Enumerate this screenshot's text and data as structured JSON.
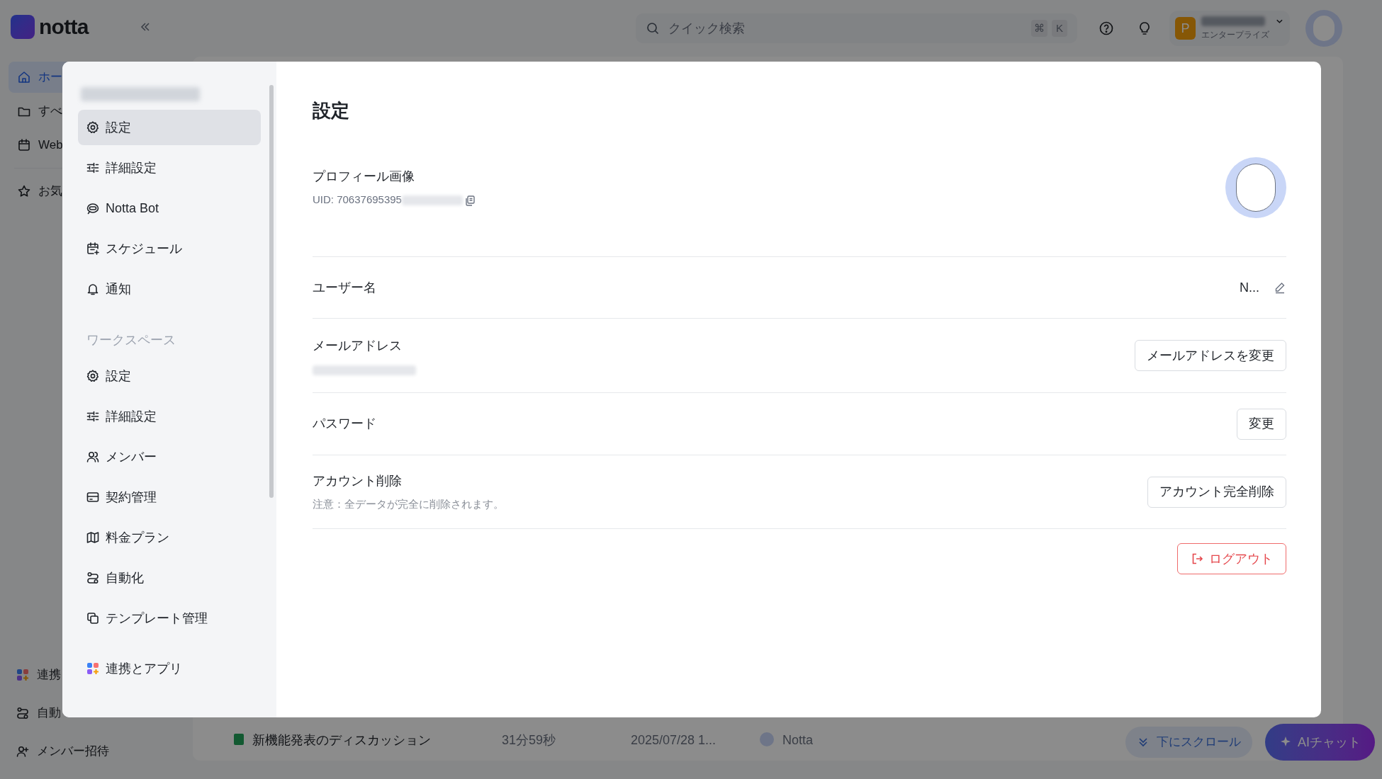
{
  "app": {
    "logo": "notta",
    "search_placeholder": "クイック検索",
    "shortcut_keys": [
      "⌘",
      "K"
    ],
    "user_initial": "P",
    "plan": "エンタープライズ"
  },
  "background_sidebar": {
    "items": [
      {
        "label": "ホー",
        "kind": "home",
        "selected": true
      },
      {
        "label": "すべ",
        "kind": "folder",
        "selected": false
      },
      {
        "label": "Web",
        "kind": "calendar",
        "selected": false
      },
      {
        "label": "お気",
        "kind": "star",
        "selected": false
      }
    ],
    "bottom_items": [
      {
        "label": "連携",
        "kind": "apps"
      },
      {
        "label": "自動",
        "kind": "flow"
      },
      {
        "label": "メンバー招待",
        "kind": "invite"
      }
    ]
  },
  "background_list": {
    "row": {
      "title": "新機能発表のディスカッション",
      "duration": "31分59秒",
      "date": "2025/07/28 1...",
      "owner": "Notta"
    }
  },
  "floating_buttons": [
    {
      "label": "下にスクロール",
      "kind": "scroll"
    },
    {
      "label": "AIチャット",
      "kind": "ai"
    }
  ],
  "modal": {
    "sidebar": {
      "personal_items": [
        {
          "label": "設定",
          "kind": "gear",
          "selected": true
        },
        {
          "label": "詳細設定",
          "kind": "sliders",
          "selected": false
        },
        {
          "label": "Notta Bot",
          "kind": "bot",
          "selected": false
        },
        {
          "label": "スケジュール",
          "kind": "schedule",
          "selected": false
        },
        {
          "label": "通知",
          "kind": "bell",
          "selected": false
        }
      ],
      "section_label": "ワークスペース",
      "workspace_items": [
        {
          "label": "設定",
          "kind": "gear",
          "selected": false
        },
        {
          "label": "詳細設定",
          "kind": "sliders",
          "selected": false
        },
        {
          "label": "メンバー",
          "kind": "users",
          "selected": false
        },
        {
          "label": "契約管理",
          "kind": "card",
          "selected": false
        },
        {
          "label": "料金プラン",
          "kind": "map",
          "selected": false
        },
        {
          "label": "自動化",
          "kind": "flow",
          "selected": false
        },
        {
          "label": "テンプレート管理",
          "kind": "copy",
          "selected": false
        }
      ],
      "footer_item": {
        "label": "連携とアプリ",
        "kind": "apps",
        "selected": false
      }
    },
    "content": {
      "title": "設定",
      "rows": [
        {
          "kind": "profile",
          "label": "プロフィール画像",
          "uid": "UID: 70637695395"
        },
        {
          "kind": "username",
          "label": "ユーザー名",
          "value": "N..."
        },
        {
          "kind": "email",
          "label": "メールアドレス",
          "button": "メールアドレスを変更"
        },
        {
          "kind": "password",
          "label": "パスワード",
          "button": "変更"
        },
        {
          "kind": "delete",
          "label": "アカウント削除",
          "note": "注意：全データが完全に削除されます。",
          "button": "アカウント完全削除"
        }
      ],
      "logout": "ログアウト"
    }
  }
}
